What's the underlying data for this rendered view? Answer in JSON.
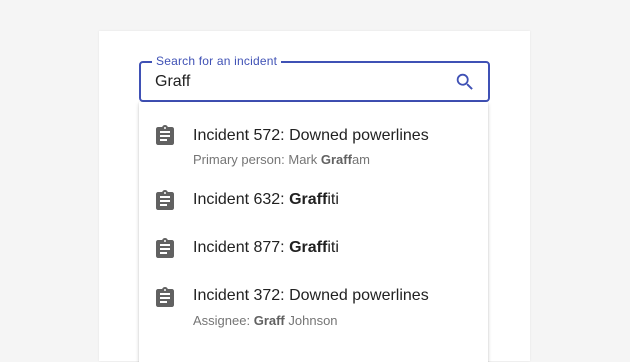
{
  "search": {
    "label": "Search for an incident",
    "value": "Graff",
    "icon": "search-icon",
    "accent_color": "#3f51b5"
  },
  "results": [
    {
      "icon": "clipboard-icon",
      "title_prefix": "Incident 572: Downed powerlines",
      "title_match": "",
      "title_suffix": "",
      "sub_prefix": "Primary person: Mark ",
      "sub_match": "Graff",
      "sub_suffix": "am"
    },
    {
      "icon": "clipboard-icon",
      "title_prefix": "Incident 632: ",
      "title_match": "Graff",
      "title_suffix": "iti"
    },
    {
      "icon": "clipboard-icon",
      "title_prefix": "Incident 877: ",
      "title_match": "Graff",
      "title_suffix": "iti"
    },
    {
      "icon": "clipboard-icon",
      "title_prefix": "Incident 372: Downed powerlines",
      "title_match": "",
      "title_suffix": "",
      "sub_prefix": "Assignee: ",
      "sub_match": "Graff",
      "sub_suffix": " Johnson"
    }
  ]
}
